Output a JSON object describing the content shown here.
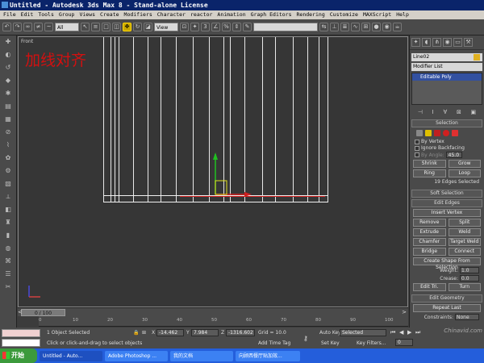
{
  "window": {
    "title": "Untitled - Autodesk 3ds Max 8  - Stand-alone License"
  },
  "menu": [
    "File",
    "Edit",
    "Tools",
    "Group",
    "Views",
    "Create",
    "Modifiers",
    "Character",
    "reactor",
    "Animation",
    "Graph Editors",
    "Rendering",
    "Customize",
    "MAXScript",
    "Help"
  ],
  "toolbar": {
    "selection_filter": "All",
    "reference_coord": "View",
    "named_sel_field": ""
  },
  "viewport": {
    "label": "Front",
    "caption": "加线对齐"
  },
  "timeline": {
    "slider_text": "0 / 100",
    "ticks": [
      "0",
      "10",
      "20",
      "30",
      "40",
      "50",
      "60",
      "70",
      "80",
      "90",
      "100"
    ]
  },
  "status": {
    "selected_count": "1 Object Selected",
    "prompt": "Click or click-and-drag to select objects",
    "x_label": "X",
    "x_value": "-14.462",
    "y_label": "Y",
    "y_value": "7.984",
    "z_label": "Z",
    "z_value": "-1316.602",
    "grid": "Grid = 10.0",
    "add_time_tag": "Add Time Tag",
    "auto_key": "Auto Key",
    "key_mode": "Selected",
    "set_key": "Set Key",
    "key_filters": "Key Filters...",
    "frame": "0"
  },
  "taskbar": {
    "start": "开始",
    "items": [
      "Untitled - Auto...",
      "Adobe Photoshop ...",
      "我的文档",
      "向顾西餐厅贴加效..."
    ]
  },
  "command_panel": {
    "object_name": "Line02",
    "modifier_list": "Modifier List",
    "stack_item": "Editable Poly",
    "selection": {
      "header": "Selection",
      "by_vertex": "By Vertex",
      "ignore_backfacing": "Ignore Backfacing",
      "by_angle": "By Angle:",
      "by_angle_value": "45.0",
      "shrink": "Shrink",
      "grow": "Grow",
      "ring": "Ring",
      "loop": "Loop",
      "status": "19 Edges Selected"
    },
    "soft_selection": "Soft Selection",
    "edit_edges": {
      "header": "Edit Edges",
      "insert_vertex": "Insert Vertex",
      "remove": "Remove",
      "split": "Split",
      "extrude": "Extrude",
      "weld": "Weld",
      "chamfer": "Chamfer",
      "target_weld": "Target Weld",
      "bridge": "Bridge",
      "connect": "Connect",
      "create_shape": "Create Shape From Selection",
      "weight_label": "Weight:",
      "weight_value": "1.0",
      "crease_label": "Crease:",
      "crease_value": "0.0",
      "edit_tri": "Edit Tri.",
      "turn": "Turn"
    },
    "edit_geometry": {
      "header": "Edit Geometry",
      "repeat_last": "Repeat Last",
      "constraints_label": "Constraints:",
      "constraints_value": "None"
    }
  },
  "watermark": "Chinavid.com",
  "colors": {
    "accent_yellow": "#c8a800",
    "caption_red": "#d21010",
    "stack_blue": "#3250a0"
  }
}
